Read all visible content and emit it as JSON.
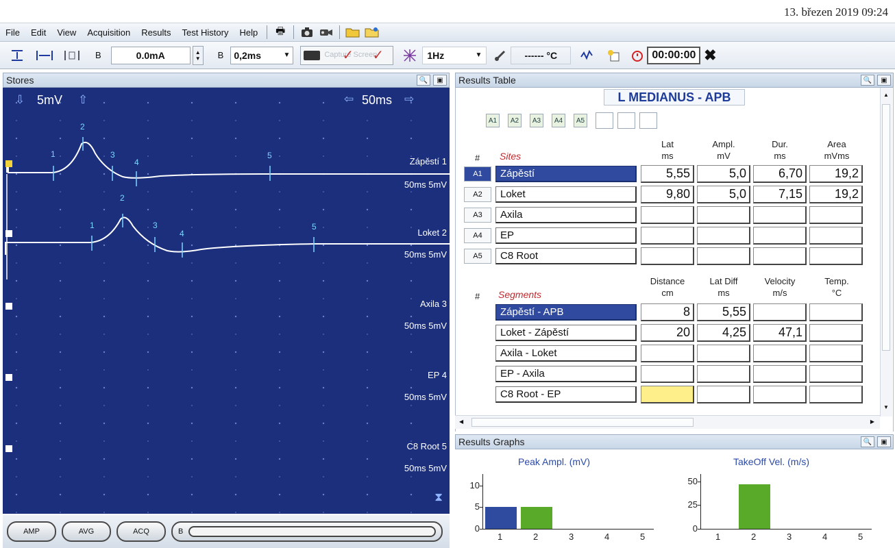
{
  "datetime": "13. březen 2019 09:24",
  "menu": {
    "items": [
      "File",
      "Edit",
      "View",
      "Acquisition",
      "Results",
      "Test History",
      "Help"
    ]
  },
  "toolbar": {
    "channel_a": "B",
    "current": "0.0mA",
    "channel_b": "B",
    "duration": "0,2ms",
    "capture_label": "Capture Screen",
    "rate": "1Hz",
    "temp": "------ °C",
    "timer": "00:00:00"
  },
  "stores": {
    "title": "Stores",
    "sensitivity": "5mV",
    "sweep": "50ms",
    "traces": [
      {
        "label": "Zápěstí 1",
        "scale": "50ms 5mV"
      },
      {
        "label": "Loket 2",
        "scale": "50ms 5mV"
      },
      {
        "label": "Axila 3",
        "scale": "50ms 5mV"
      },
      {
        "label": "EP 4",
        "scale": "50ms 5mV"
      },
      {
        "label": "C8 Root 5",
        "scale": "50ms 5mV"
      }
    ],
    "cursor_labels": [
      "1",
      "2",
      "3",
      "4",
      "5"
    ],
    "buttons": [
      "AMP",
      "AVG",
      "ACQ",
      "B"
    ]
  },
  "results_table": {
    "title": "Results Table",
    "heading": "L MEDIANUS - APB",
    "site_buttons": [
      "A1",
      "A2",
      "A3",
      "A4",
      "A5"
    ],
    "sites_hash": "#",
    "sites_label": "Sites",
    "site_columns": [
      {
        "l1": "Lat",
        "l2": "ms"
      },
      {
        "l1": "Ampl.",
        "l2": "mV"
      },
      {
        "l1": "Dur.",
        "l2": "ms"
      },
      {
        "l1": "Area",
        "l2": "mVms"
      }
    ],
    "sites": [
      {
        "id": "A1",
        "name": "Zápěstí",
        "values": [
          "5,55",
          "5,0",
          "6,70",
          "19,2"
        ]
      },
      {
        "id": "A2",
        "name": "Loket",
        "values": [
          "9,80",
          "5,0",
          "7,15",
          "19,2"
        ]
      },
      {
        "id": "A3",
        "name": "Axila",
        "values": [
          "",
          "",
          "",
          ""
        ]
      },
      {
        "id": "A4",
        "name": "EP",
        "values": [
          "",
          "",
          "",
          ""
        ]
      },
      {
        "id": "A5",
        "name": "C8 Root",
        "values": [
          "",
          "",
          "",
          ""
        ]
      }
    ],
    "segments_hash": "#",
    "segments_label": "Segments",
    "segment_columns": [
      {
        "l1": "Distance",
        "l2": "cm"
      },
      {
        "l1": "Lat Diff",
        "l2": "ms"
      },
      {
        "l1": "Velocity",
        "l2": "m/s"
      },
      {
        "l1": "Temp.",
        "l2": "°C"
      }
    ],
    "segments": [
      {
        "name": "Zápěstí - APB",
        "values": [
          "8",
          "5,55",
          "",
          ""
        ]
      },
      {
        "name": "Loket - Zápěstí",
        "values": [
          "20",
          "4,25",
          "47,1",
          ""
        ]
      },
      {
        "name": "Axila - Loket",
        "values": [
          "",
          "",
          "",
          ""
        ]
      },
      {
        "name": "EP - Axila",
        "values": [
          "",
          "",
          "",
          ""
        ]
      },
      {
        "name": "C8 Root - EP",
        "values": [
          "",
          "",
          "",
          ""
        ]
      }
    ]
  },
  "results_graphs": {
    "title": "Results Graphs",
    "colors": {
      "bar1": "#2e4b9f",
      "bar2": "#5aaa2a"
    }
  },
  "chart_data": [
    {
      "type": "bar",
      "title": "Peak Ampl. (mV)",
      "categories": [
        "1",
        "2",
        "3",
        "4",
        "5"
      ],
      "values": [
        5.0,
        5.0,
        null,
        null,
        null
      ],
      "yticks": [
        "10",
        "5",
        "0"
      ],
      "ylim": [
        0,
        12
      ]
    },
    {
      "type": "bar",
      "title": "TakeOff Vel. (m/s)",
      "categories": [
        "1",
        "2",
        "3",
        "4",
        "5"
      ],
      "values": [
        null,
        47.1,
        null,
        null,
        null
      ],
      "yticks": [
        "50",
        "25",
        "0"
      ],
      "ylim": [
        0,
        55
      ]
    }
  ]
}
